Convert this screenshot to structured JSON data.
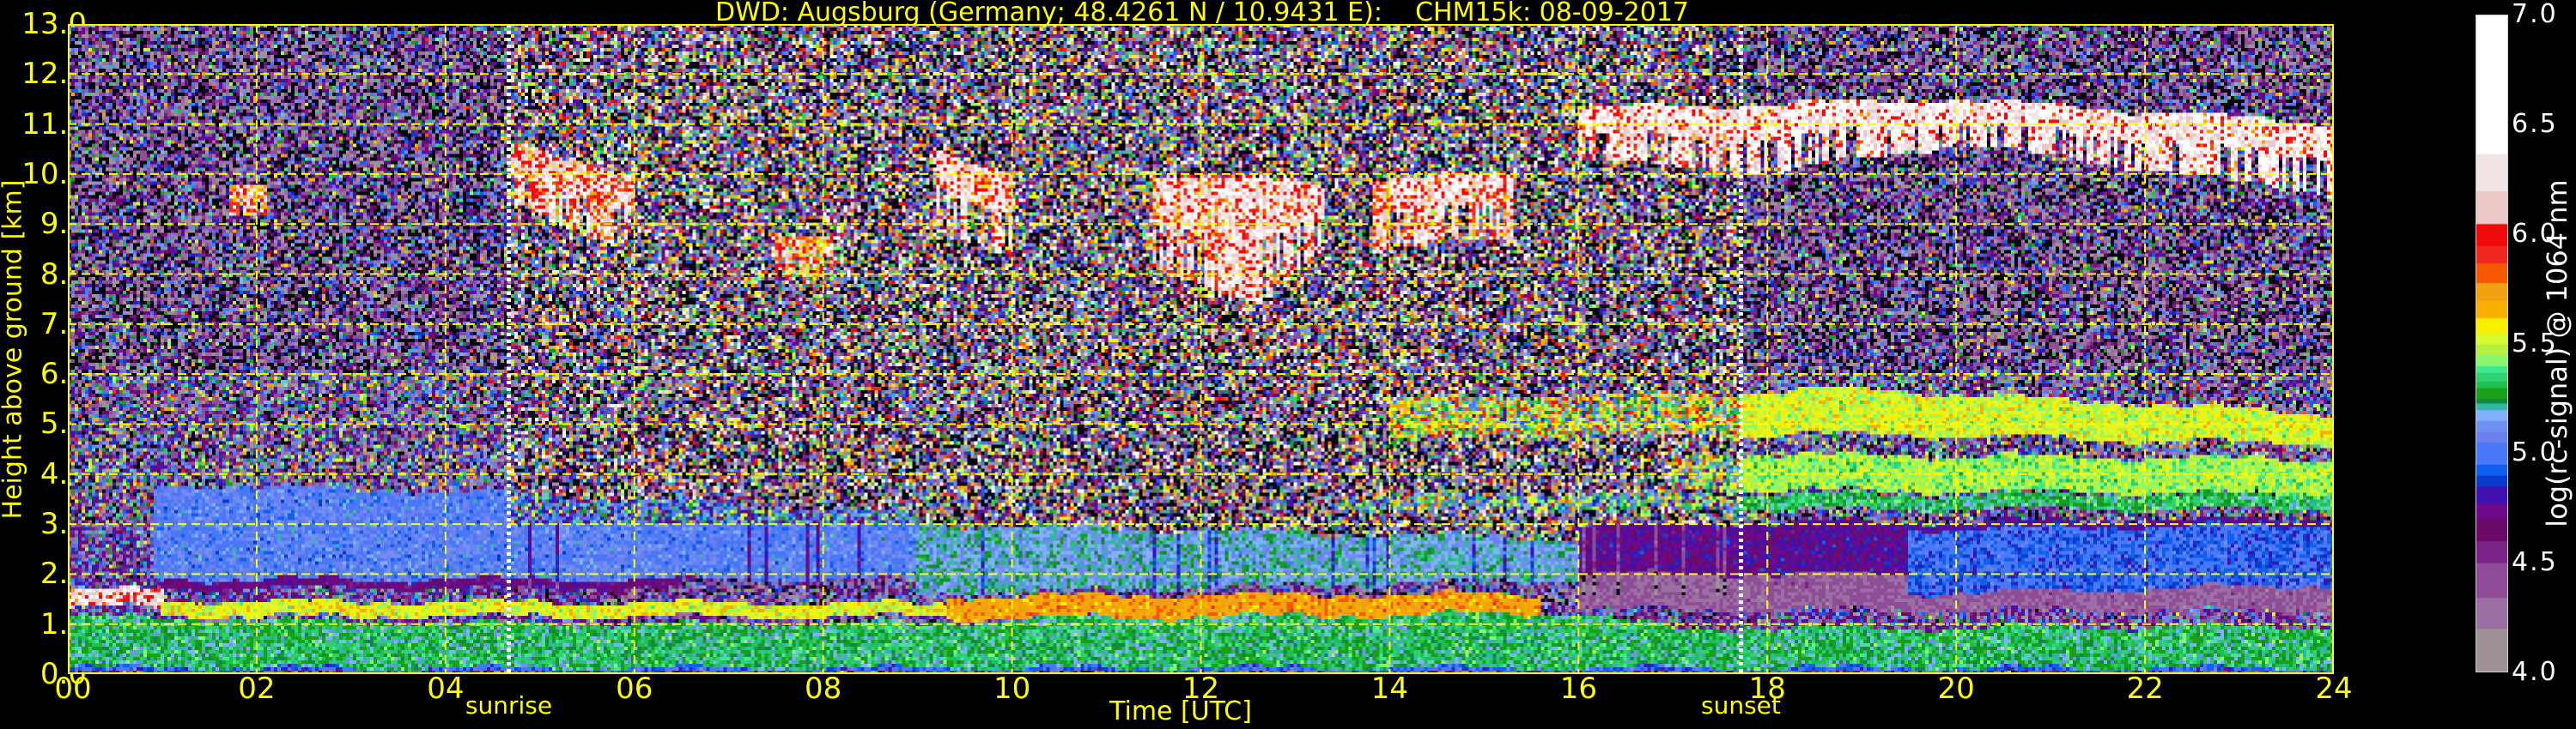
{
  "chart_data": {
    "type": "heatmap",
    "title": "DWD: Augsburg (Germany; 48.4261 N / 10.9431 E):    CHM15k: 08-09-2017",
    "xlabel": "Time [UTC]",
    "ylabel": "Height above ground [km]",
    "xlim": [
      0,
      24
    ],
    "ylim": [
      0,
      13
    ],
    "xticks": [
      "00",
      "02",
      "04",
      "06",
      "08",
      "10",
      "12",
      "14",
      "16",
      "18",
      "20",
      "22",
      "24"
    ],
    "xtick_values": [
      0,
      2,
      4,
      6,
      8,
      10,
      12,
      14,
      16,
      18,
      20,
      22,
      24
    ],
    "yticks": [
      "0.0",
      "1.0",
      "2.0",
      "3.0",
      "4.0",
      "5.0",
      "6.0",
      "7.0",
      "8.0",
      "9.0",
      "10.0",
      "11.0",
      "12.0",
      "13.0"
    ],
    "ytick_values": [
      0,
      1,
      2,
      3,
      4,
      5,
      6,
      7,
      8,
      9,
      10,
      11,
      12,
      13
    ],
    "grid": true,
    "events": [
      {
        "label": "sunrise",
        "time": 4.67
      },
      {
        "label": "sunset",
        "time": 17.72
      }
    ],
    "colorbar": {
      "label": "log(rc-signal) @ 1064 nm",
      "range": [
        4.0,
        7.0
      ],
      "ticks": [
        "4.0",
        "4.5",
        "5.0",
        "5.5",
        "6.0",
        "6.5",
        "7.0"
      ],
      "tick_values": [
        4.0,
        4.5,
        5.0,
        5.5,
        6.0,
        6.5,
        7.0
      ],
      "bounds": [
        4.0,
        4.2,
        4.34,
        4.5,
        4.6,
        4.7,
        4.77,
        4.85,
        4.9,
        4.95,
        5.05,
        5.1,
        5.15,
        5.2,
        5.23,
        5.25,
        5.3,
        5.33,
        5.37,
        5.4,
        5.45,
        5.5,
        5.55,
        5.62,
        5.7,
        5.78,
        5.87,
        5.95,
        6.05,
        6.2,
        6.37,
        7.0
      ],
      "colors": [
        "#9e9198",
        "#9b6fa3",
        "#8e4d96",
        "#7a2387",
        "#6b0a68",
        "#6e0a8a",
        "#4010b0",
        "#0a3ccc",
        "#1060f0",
        "#4878f8",
        "#6c80f0",
        "#7090f4",
        "#80b0fc",
        "#30b8a0",
        "#108840",
        "#18a018",
        "#20c050",
        "#30d070",
        "#40e890",
        "#88f870",
        "#b8f040",
        "#d8fa30",
        "#f8f000",
        "#f8b000",
        "#f0a010",
        "#f85800",
        "#f02820",
        "#f00a0a",
        "#ecc8c8",
        "#f0e4e4",
        "#ffffff"
      ]
    },
    "layers": [
      {
        "name": "near-ground",
        "t": [
          0,
          24
        ],
        "base": [
          [
            0,
            0
          ],
          [
            24,
            0
          ]
        ],
        "top": [
          [
            0,
            0.12
          ],
          [
            24,
            0.12
          ]
        ],
        "value": 4.95
      },
      {
        "name": "boundary-layer",
        "t": [
          0,
          24
        ],
        "base": [
          [
            0,
            0.12
          ],
          [
            24,
            0.12
          ]
        ],
        "top": [
          [
            0,
            1.15
          ],
          [
            4,
            1.0
          ],
          [
            9,
            1.0
          ],
          [
            12,
            1.2
          ],
          [
            16,
            1.2
          ],
          [
            17,
            0.9
          ],
          [
            24,
            0.95
          ]
        ],
        "value": 5.28
      },
      {
        "name": "bl-top-night",
        "t": [
          0,
          1
        ],
        "base": [
          [
            0,
            1.3
          ],
          [
            1,
            1.35
          ]
        ],
        "top": [
          [
            0,
            1.65
          ],
          [
            1,
            1.7
          ]
        ],
        "value": 6.2
      },
      {
        "name": "bl-top-yellow",
        "t": [
          1,
          9.3
        ],
        "base": [
          [
            1,
            1.15
          ],
          [
            9.3,
            1.15
          ]
        ],
        "top": [
          [
            1,
            1.45
          ],
          [
            9.3,
            1.4
          ]
        ],
        "value": 5.55
      },
      {
        "name": "bl-top-day",
        "t": [
          9.3,
          15.6
        ],
        "base": [
          [
            9.3,
            1.1
          ],
          [
            15.6,
            1.2
          ]
        ],
        "top": [
          [
            9.3,
            1.55
          ],
          [
            15.6,
            1.6
          ]
        ],
        "value": 5.72
      },
      {
        "name": "residual-line",
        "t": [
          1,
          6.5
        ],
        "base": [
          [
            1,
            1.72
          ],
          [
            6.5,
            1.72
          ]
        ],
        "top": [
          [
            1,
            1.9
          ],
          [
            6.5,
            1.9
          ]
        ],
        "value": 4.7
      },
      {
        "name": "aerosol-blue",
        "t": [
          0.9,
          9
        ],
        "base": [
          [
            0.9,
            1.9
          ],
          [
            9,
            1.9
          ]
        ],
        "top": [
          [
            0.9,
            3.8
          ],
          [
            5,
            3.6
          ],
          [
            9,
            3.2
          ]
        ],
        "value": 5.05
      },
      {
        "name": "aerosol-green",
        "t": [
          9,
          16
        ],
        "base": [
          [
            9,
            1.6
          ],
          [
            16,
            1.9
          ]
        ],
        "top": [
          [
            9,
            3.0
          ],
          [
            16,
            2.7
          ]
        ],
        "value": 5.18
      },
      {
        "name": "evening-gray",
        "t": [
          16,
          24
        ],
        "base": [
          [
            16,
            1.3
          ],
          [
            24,
            1.25
          ]
        ],
        "top": [
          [
            16,
            2.0
          ],
          [
            24,
            2.0
          ]
        ],
        "value": 4.35
      },
      {
        "name": "evening-purple",
        "t": [
          16,
          24
        ],
        "base": [
          [
            16,
            2.0
          ],
          [
            24,
            2.0
          ]
        ],
        "top": [
          [
            16,
            3.0
          ],
          [
            24,
            3.1
          ]
        ],
        "value": 4.75
      },
      {
        "name": "evening-blue",
        "t": [
          19.5,
          24
        ],
        "base": [
          [
            19.5,
            1.6
          ],
          [
            24,
            1.8
          ]
        ],
        "top": [
          [
            19.5,
            2.9
          ],
          [
            24,
            3.0
          ]
        ],
        "value": 4.95
      },
      {
        "name": "elevated-layer-upper",
        "t": [
          14,
          24
        ],
        "base": [
          [
            14,
            4.7
          ],
          [
            19,
            4.8
          ],
          [
            24,
            4.6
          ]
        ],
        "top": [
          [
            14,
            5.5
          ],
          [
            19,
            5.7
          ],
          [
            24,
            5.2
          ]
        ],
        "value": 5.52
      },
      {
        "name": "elevated-layer-mid",
        "t": [
          17,
          24
        ],
        "base": [
          [
            17,
            3.7
          ],
          [
            24,
            3.6
          ]
        ],
        "top": [
          [
            17,
            4.4
          ],
          [
            24,
            4.3
          ]
        ],
        "value": 5.45
      },
      {
        "name": "elevated-layer-low",
        "t": [
          13.5,
          24
        ],
        "base": [
          [
            13.5,
            3.3
          ],
          [
            24,
            3.3
          ]
        ],
        "top": [
          [
            13.5,
            3.6
          ],
          [
            24,
            3.6
          ]
        ],
        "value": 5.3
      },
      {
        "name": "cirrus-morning",
        "t": [
          4.7,
          6
        ],
        "base": [
          [
            4.7,
            9.4
          ],
          [
            6,
            8.5
          ]
        ],
        "top": [
          [
            4.7,
            10.6
          ],
          [
            6,
            10.0
          ]
        ],
        "value": 6.1
      },
      {
        "name": "cirrus-early",
        "t": [
          1.7,
          2.1
        ],
        "base": [
          [
            1.7,
            9.2
          ],
          [
            2.1,
            9.2
          ]
        ],
        "top": [
          [
            1.7,
            9.8
          ],
          [
            2.1,
            9.8
          ]
        ],
        "value": 6.0
      },
      {
        "name": "fallstreak-a",
        "t": [
          7.5,
          8.1
        ],
        "base": [
          [
            7.5,
            8.0
          ],
          [
            8.1,
            8.0
          ]
        ],
        "top": [
          [
            7.5,
            8.8
          ],
          [
            8.1,
            8.8
          ]
        ],
        "value": 6.0
      },
      {
        "name": "fallstreak-b",
        "t": [
          9.2,
          10.0
        ],
        "base": [
          [
            9.2,
            9.0
          ],
          [
            10,
            8.4
          ]
        ],
        "top": [
          [
            9.2,
            10.5
          ],
          [
            10,
            10.0
          ]
        ],
        "value": 6.2
      },
      {
        "name": "fallstreak-c",
        "t": [
          11.5,
          13.3
        ],
        "base": [
          [
            11.5,
            8.2
          ],
          [
            12.6,
            7.3
          ],
          [
            13.3,
            8.5
          ]
        ],
        "top": [
          [
            11.5,
            10.0
          ],
          [
            13.3,
            9.8
          ]
        ],
        "value": 6.2
      },
      {
        "name": "fallstreak-d",
        "t": [
          13.8,
          15.3
        ],
        "base": [
          [
            13.8,
            8.5
          ],
          [
            15.3,
            8.7
          ]
        ],
        "top": [
          [
            13.8,
            9.9
          ],
          [
            15.3,
            10.0
          ]
        ],
        "value": 6.2
      },
      {
        "name": "cirrus-evening",
        "t": [
          16,
          24
        ],
        "base": [
          [
            16,
            10.3
          ],
          [
            18,
            10.0
          ],
          [
            20,
            10.6
          ],
          [
            24,
            9.6
          ]
        ],
        "top": [
          [
            16,
            11.3
          ],
          [
            20,
            11.5
          ],
          [
            24,
            11.0
          ]
        ],
        "value": 6.3
      }
    ]
  }
}
